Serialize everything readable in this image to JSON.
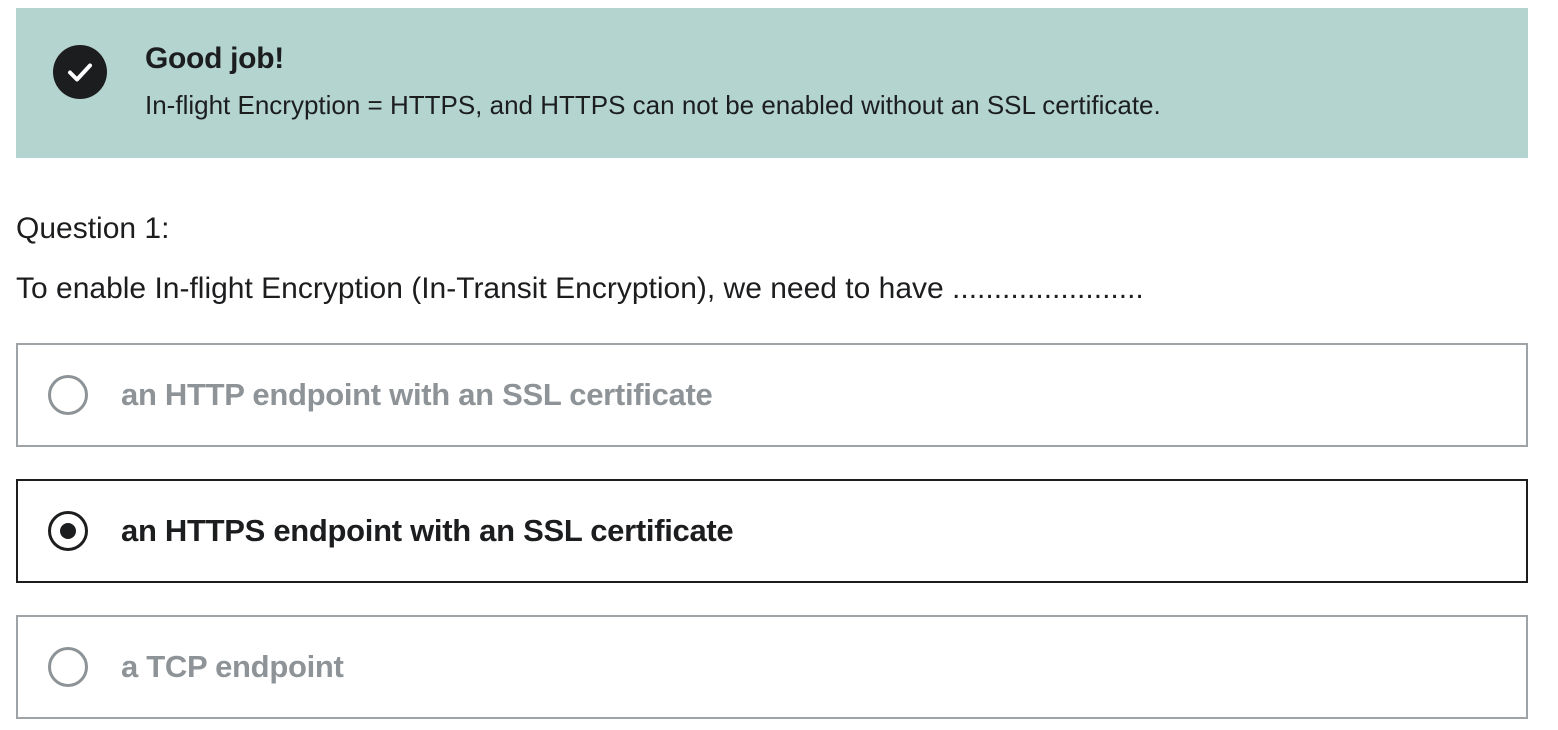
{
  "feedback": {
    "icon": "check-circle-icon",
    "title": "Good job!",
    "message": "In-flight Encryption = HTTPS, and HTTPS can not be enabled without an SSL certificate.",
    "background_color": "#b3d4cf"
  },
  "question": {
    "label": "Question 1:",
    "prompt": "To enable In-flight Encryption (In-Transit Encryption), we need to have ......................."
  },
  "options": [
    {
      "label": "an HTTP endpoint with an SSL certificate",
      "selected": false
    },
    {
      "label": "an HTTPS endpoint with an SSL certificate",
      "selected": true
    },
    {
      "label": "a TCP endpoint",
      "selected": false
    }
  ]
}
